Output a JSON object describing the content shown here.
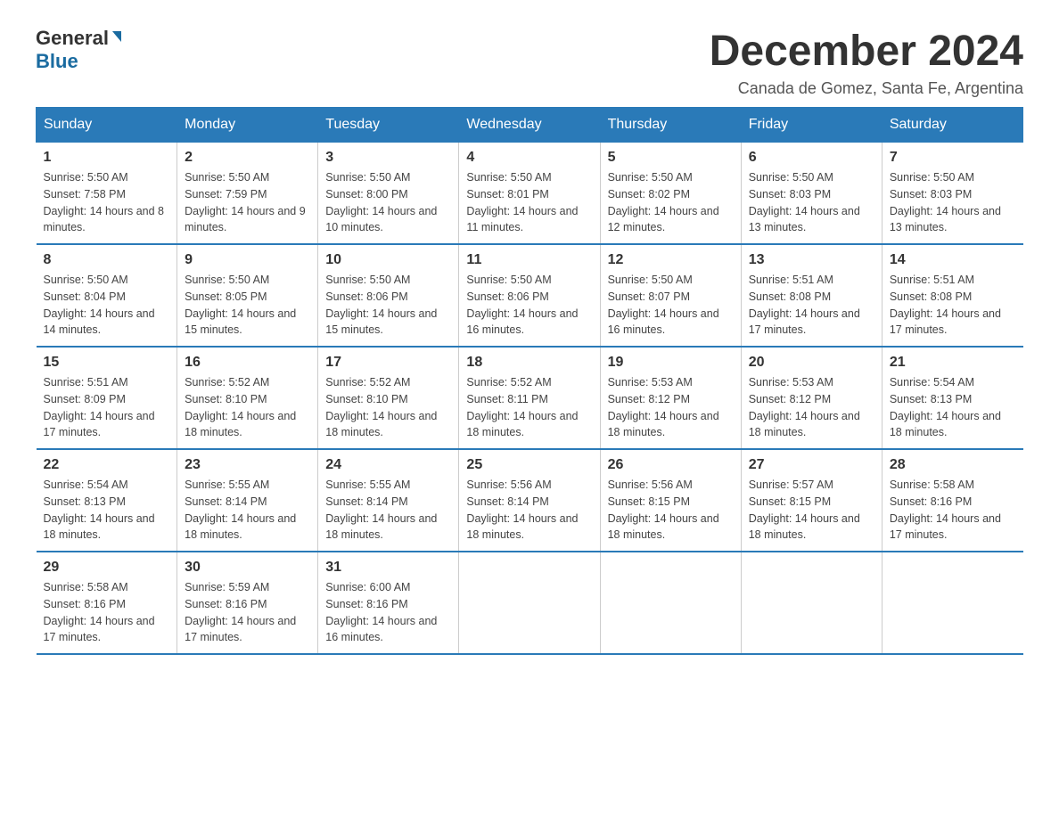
{
  "logo": {
    "general": "General",
    "blue": "Blue"
  },
  "title": "December 2024",
  "subtitle": "Canada de Gomez, Santa Fe, Argentina",
  "days_of_week": [
    "Sunday",
    "Monday",
    "Tuesday",
    "Wednesday",
    "Thursday",
    "Friday",
    "Saturday"
  ],
  "weeks": [
    [
      {
        "day": "1",
        "sunrise": "5:50 AM",
        "sunset": "7:58 PM",
        "daylight": "14 hours and 8 minutes."
      },
      {
        "day": "2",
        "sunrise": "5:50 AM",
        "sunset": "7:59 PM",
        "daylight": "14 hours and 9 minutes."
      },
      {
        "day": "3",
        "sunrise": "5:50 AM",
        "sunset": "8:00 PM",
        "daylight": "14 hours and 10 minutes."
      },
      {
        "day": "4",
        "sunrise": "5:50 AM",
        "sunset": "8:01 PM",
        "daylight": "14 hours and 11 minutes."
      },
      {
        "day": "5",
        "sunrise": "5:50 AM",
        "sunset": "8:02 PM",
        "daylight": "14 hours and 12 minutes."
      },
      {
        "day": "6",
        "sunrise": "5:50 AM",
        "sunset": "8:03 PM",
        "daylight": "14 hours and 13 minutes."
      },
      {
        "day": "7",
        "sunrise": "5:50 AM",
        "sunset": "8:03 PM",
        "daylight": "14 hours and 13 minutes."
      }
    ],
    [
      {
        "day": "8",
        "sunrise": "5:50 AM",
        "sunset": "8:04 PM",
        "daylight": "14 hours and 14 minutes."
      },
      {
        "day": "9",
        "sunrise": "5:50 AM",
        "sunset": "8:05 PM",
        "daylight": "14 hours and 15 minutes."
      },
      {
        "day": "10",
        "sunrise": "5:50 AM",
        "sunset": "8:06 PM",
        "daylight": "14 hours and 15 minutes."
      },
      {
        "day": "11",
        "sunrise": "5:50 AM",
        "sunset": "8:06 PM",
        "daylight": "14 hours and 16 minutes."
      },
      {
        "day": "12",
        "sunrise": "5:50 AM",
        "sunset": "8:07 PM",
        "daylight": "14 hours and 16 minutes."
      },
      {
        "day": "13",
        "sunrise": "5:51 AM",
        "sunset": "8:08 PM",
        "daylight": "14 hours and 17 minutes."
      },
      {
        "day": "14",
        "sunrise": "5:51 AM",
        "sunset": "8:08 PM",
        "daylight": "14 hours and 17 minutes."
      }
    ],
    [
      {
        "day": "15",
        "sunrise": "5:51 AM",
        "sunset": "8:09 PM",
        "daylight": "14 hours and 17 minutes."
      },
      {
        "day": "16",
        "sunrise": "5:52 AM",
        "sunset": "8:10 PM",
        "daylight": "14 hours and 18 minutes."
      },
      {
        "day": "17",
        "sunrise": "5:52 AM",
        "sunset": "8:10 PM",
        "daylight": "14 hours and 18 minutes."
      },
      {
        "day": "18",
        "sunrise": "5:52 AM",
        "sunset": "8:11 PM",
        "daylight": "14 hours and 18 minutes."
      },
      {
        "day": "19",
        "sunrise": "5:53 AM",
        "sunset": "8:12 PM",
        "daylight": "14 hours and 18 minutes."
      },
      {
        "day": "20",
        "sunrise": "5:53 AM",
        "sunset": "8:12 PM",
        "daylight": "14 hours and 18 minutes."
      },
      {
        "day": "21",
        "sunrise": "5:54 AM",
        "sunset": "8:13 PM",
        "daylight": "14 hours and 18 minutes."
      }
    ],
    [
      {
        "day": "22",
        "sunrise": "5:54 AM",
        "sunset": "8:13 PM",
        "daylight": "14 hours and 18 minutes."
      },
      {
        "day": "23",
        "sunrise": "5:55 AM",
        "sunset": "8:14 PM",
        "daylight": "14 hours and 18 minutes."
      },
      {
        "day": "24",
        "sunrise": "5:55 AM",
        "sunset": "8:14 PM",
        "daylight": "14 hours and 18 minutes."
      },
      {
        "day": "25",
        "sunrise": "5:56 AM",
        "sunset": "8:14 PM",
        "daylight": "14 hours and 18 minutes."
      },
      {
        "day": "26",
        "sunrise": "5:56 AM",
        "sunset": "8:15 PM",
        "daylight": "14 hours and 18 minutes."
      },
      {
        "day": "27",
        "sunrise": "5:57 AM",
        "sunset": "8:15 PM",
        "daylight": "14 hours and 18 minutes."
      },
      {
        "day": "28",
        "sunrise": "5:58 AM",
        "sunset": "8:16 PM",
        "daylight": "14 hours and 17 minutes."
      }
    ],
    [
      {
        "day": "29",
        "sunrise": "5:58 AM",
        "sunset": "8:16 PM",
        "daylight": "14 hours and 17 minutes."
      },
      {
        "day": "30",
        "sunrise": "5:59 AM",
        "sunset": "8:16 PM",
        "daylight": "14 hours and 17 minutes."
      },
      {
        "day": "31",
        "sunrise": "6:00 AM",
        "sunset": "8:16 PM",
        "daylight": "14 hours and 16 minutes."
      },
      null,
      null,
      null,
      null
    ]
  ],
  "labels": {
    "sunrise": "Sunrise:",
    "sunset": "Sunset:",
    "daylight": "Daylight:"
  }
}
